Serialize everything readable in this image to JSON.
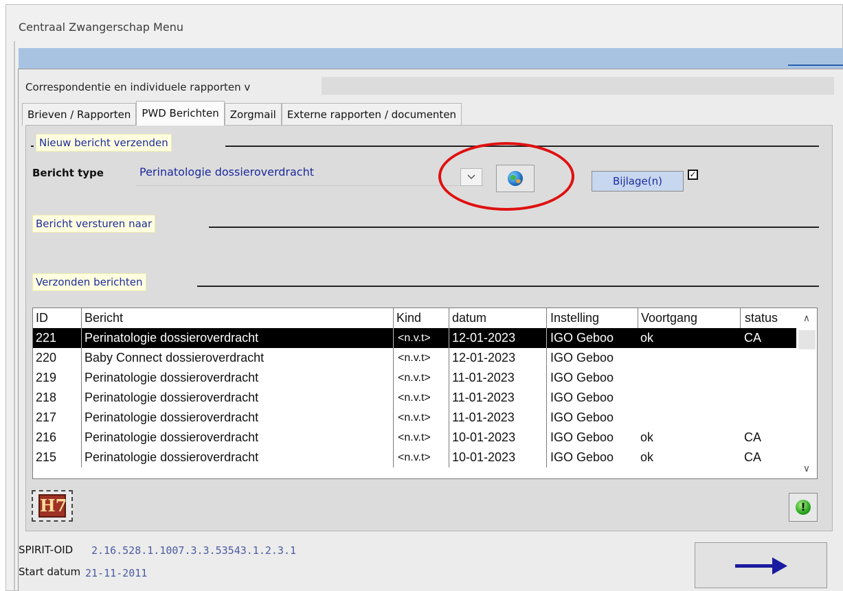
{
  "window": {
    "title": "Centraal Zwangerschap Menu"
  },
  "dialog": {
    "title": "Correspondentie en individuele rapporten v"
  },
  "tabs": [
    {
      "label": "Brieven / Rapporten"
    },
    {
      "label": "PWD Berichten"
    },
    {
      "label": "Zorgmail"
    },
    {
      "label": "Externe rapporten / documenten"
    }
  ],
  "active_tab": "PWD Berichten",
  "sections": {
    "new_message": "Nieuw bericht verzenden",
    "send_to": "Bericht versturen naar",
    "sent": "Verzonden berichten"
  },
  "form": {
    "type_label": "Bericht type",
    "type_value": "Perinatologie dossieroverdracht",
    "attachments_label": "Bijlage(n)",
    "attachments_checked": true,
    "check_glyph": "✓"
  },
  "table": {
    "headers": [
      "ID",
      "Bericht",
      "Kind",
      "datum",
      "Instelling",
      "Voortgang",
      "status"
    ],
    "rows": [
      {
        "id": "221",
        "bericht": "Perinatologie dossieroverdracht",
        "kind": "<n.v.t>",
        "datum": "12-01-2023",
        "instelling": "IGO Geboo",
        "voortgang": "ok",
        "status": "CA"
      },
      {
        "id": "220",
        "bericht": "Baby Connect dossieroverdracht",
        "kind": "<n.v.t>",
        "datum": "12-01-2023",
        "instelling": "IGO Geboo",
        "voortgang": "",
        "status": ""
      },
      {
        "id": "219",
        "bericht": "Perinatologie dossieroverdracht",
        "kind": "<n.v.t>",
        "datum": "11-01-2023",
        "instelling": "IGO Geboo",
        "voortgang": "",
        "status": ""
      },
      {
        "id": "218",
        "bericht": "Perinatologie dossieroverdracht",
        "kind": "<n.v.t>",
        "datum": "11-01-2023",
        "instelling": "IGO Geboo",
        "voortgang": "",
        "status": ""
      },
      {
        "id": "217",
        "bericht": "Perinatologie dossieroverdracht",
        "kind": "<n.v.t>",
        "datum": "11-01-2023",
        "instelling": "IGO Geboo",
        "voortgang": "",
        "status": ""
      },
      {
        "id": "216",
        "bericht": "Perinatologie dossieroverdracht",
        "kind": "<n.v.t>",
        "datum": "10-01-2023",
        "instelling": "IGO Geboo",
        "voortgang": "ok",
        "status": "CA"
      },
      {
        "id": "215",
        "bericht": "Perinatologie dossieroverdracht",
        "kind": "<n.v.t>",
        "datum": "10-01-2023",
        "instelling": "IGO Geboo",
        "voortgang": "ok",
        "status": "CA"
      }
    ],
    "selected_row": "221",
    "scroll_up": "∧",
    "scroll_down": "∨"
  },
  "icons": {
    "combo": "chevron-down-icon",
    "globe": "globe-icon",
    "hl7": "hl7-icon",
    "hl7_text": "H7",
    "alert": "alert-icon",
    "alert_text": "!",
    "next": "arrow-right-icon"
  },
  "footer": {
    "oid_label": "SPIRIT-OID",
    "oid_value": "2.16.528.1.1007.3.3.53543.1.2.3.1",
    "start_label": "Start datum",
    "start_value": "21-11-2011"
  },
  "colors": {
    "accent_text": "#1c2a9c",
    "section_bg": "#ffffe0",
    "highlight_ring": "#e01010",
    "selected_row_bg": "#000000"
  }
}
